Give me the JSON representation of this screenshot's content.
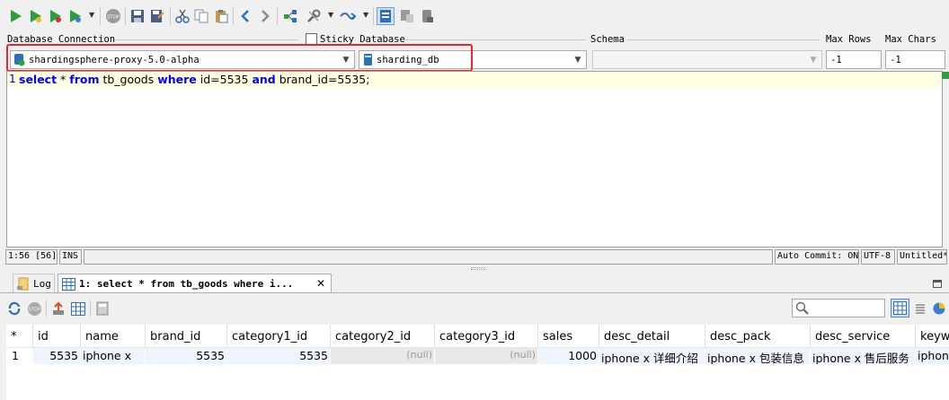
{
  "labels": {
    "database_connection": "Database Connection",
    "sticky_database": "Sticky Database",
    "schema": "Schema",
    "max_rows": "Max Rows",
    "max_chars": "Max Chars"
  },
  "connection": {
    "selected": "shardingsphere-proxy-5.0-alpha"
  },
  "database": {
    "selected": "sharding_db"
  },
  "schema": {
    "selected": ""
  },
  "max_rows": {
    "value": "-1"
  },
  "max_chars": {
    "value": "-1"
  },
  "editor": {
    "line_number": "1",
    "tokens": [
      {
        "t": "select",
        "kw": true
      },
      {
        "t": " * ",
        "kw": false
      },
      {
        "t": "from",
        "kw": true
      },
      {
        "t": " tb_goods ",
        "kw": false
      },
      {
        "t": "where",
        "kw": true
      },
      {
        "t": " id=5535 ",
        "kw": false
      },
      {
        "t": "and",
        "kw": true
      },
      {
        "t": " brand_id=5535;",
        "kw": false
      }
    ]
  },
  "status": {
    "position": "1:56 [56]",
    "mode": "INS",
    "auto_commit": "Auto Commit: ON",
    "encoding": "UTF-8",
    "doc": "Untitled*"
  },
  "tabs": {
    "log": "Log",
    "result": "1: select * from tb_goods where i..."
  },
  "grid": {
    "row_marker_header": "*",
    "columns": [
      "id",
      "name",
      "brand_id",
      "category1_id",
      "category2_id",
      "category3_id",
      "sales",
      "desc_detail",
      "desc_pack",
      "desc_service",
      "keyw"
    ],
    "rows": [
      {
        "row_number": "1",
        "cells": [
          "5535",
          "iphone x",
          "5535",
          "5535",
          "(null)",
          "(null)",
          "1000",
          "iphone x 详细介绍",
          "iphone x 包装信息",
          "iphone x 售后服务",
          "iphon"
        ]
      }
    ]
  },
  "colors": {
    "highlight_box": "#e8262b",
    "keyword": "#0000ff",
    "current_line": "#ffffe1"
  }
}
